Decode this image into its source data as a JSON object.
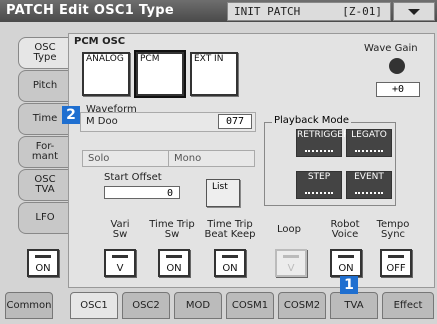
{
  "title": "PATCH Edit OSC1 Type",
  "patch": {
    "name": "INIT PATCH",
    "number": "[Z-01]"
  },
  "left_tabs": [
    "OSC\nType",
    "Pitch",
    "Time",
    "For-\nmant",
    "OSC\nTVA",
    "LFO"
  ],
  "left_switch_label": "ON",
  "pcm": {
    "label": "PCM OSC",
    "buttons": [
      "ANALOG",
      "PCM",
      "EXT IN"
    ]
  },
  "wave_gain": {
    "label": "Wave Gain",
    "value": "+0"
  },
  "waveform": {
    "label": "Waveform",
    "name": "M Doo",
    "number": "077",
    "solo": "Solo",
    "mono": "Mono"
  },
  "start_offset": {
    "label": "Start Offset",
    "value": "0"
  },
  "list_label": "List",
  "playback": {
    "label": "Playback Mode",
    "buttons": [
      "RETRIGGER",
      "LEGATO",
      "STEP",
      "EVENT"
    ]
  },
  "switches": [
    {
      "label": "Vari\nSw",
      "value": "V"
    },
    {
      "label": "Time Trip\nSw",
      "value": "ON"
    },
    {
      "label": "Time Trip\nBeat Keep",
      "value": "ON"
    },
    {
      "label": "Loop",
      "value": "V"
    },
    {
      "label": "Robot\nVoice",
      "value": "ON"
    },
    {
      "label": "Tempo\nSync",
      "value": "OFF"
    }
  ],
  "bottom_tabs": [
    "Common",
    "OSC1",
    "OSC2",
    "MOD",
    "COSM1",
    "COSM2",
    "TVA",
    "Effect"
  ],
  "markers": [
    "1",
    "2"
  ]
}
